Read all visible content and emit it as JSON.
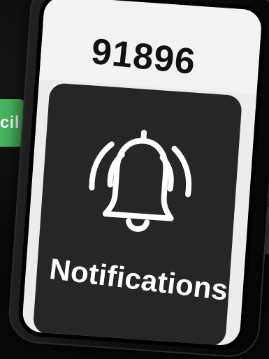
{
  "badge": {
    "text": "cil"
  },
  "screen": {
    "code": "91896",
    "notification_label": "Notifications"
  },
  "colors": {
    "badge_green": "#48b860",
    "card_dark": "#262626",
    "screen_light": "#f2f2f2"
  },
  "icons": {
    "bell": "bell-icon"
  }
}
